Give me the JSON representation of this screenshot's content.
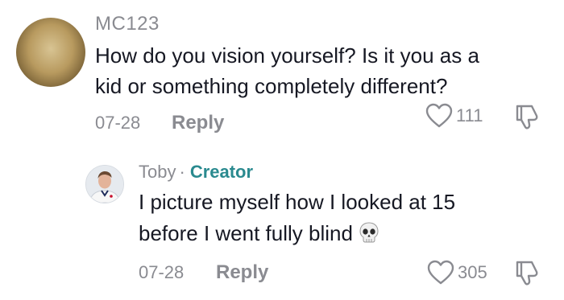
{
  "comment": {
    "username": "MC123",
    "text_line1": "How do you vision yourself? Is it you as a",
    "text_line2": "kid or something completely different?",
    "date": "07-28",
    "reply_label": "Reply",
    "like_count": "111"
  },
  "reply": {
    "username": "Toby",
    "separator": "·",
    "badge": "Creator",
    "text_line1": "I picture myself how I looked at 15",
    "text_line2": "before I went fully blind",
    "emoji_icon": "skull-icon",
    "date": "07-28",
    "reply_label": "Reply",
    "like_count": "305"
  },
  "colors": {
    "text": "#161823",
    "muted": "#8a8b91",
    "creator": "#2a8a8f"
  }
}
